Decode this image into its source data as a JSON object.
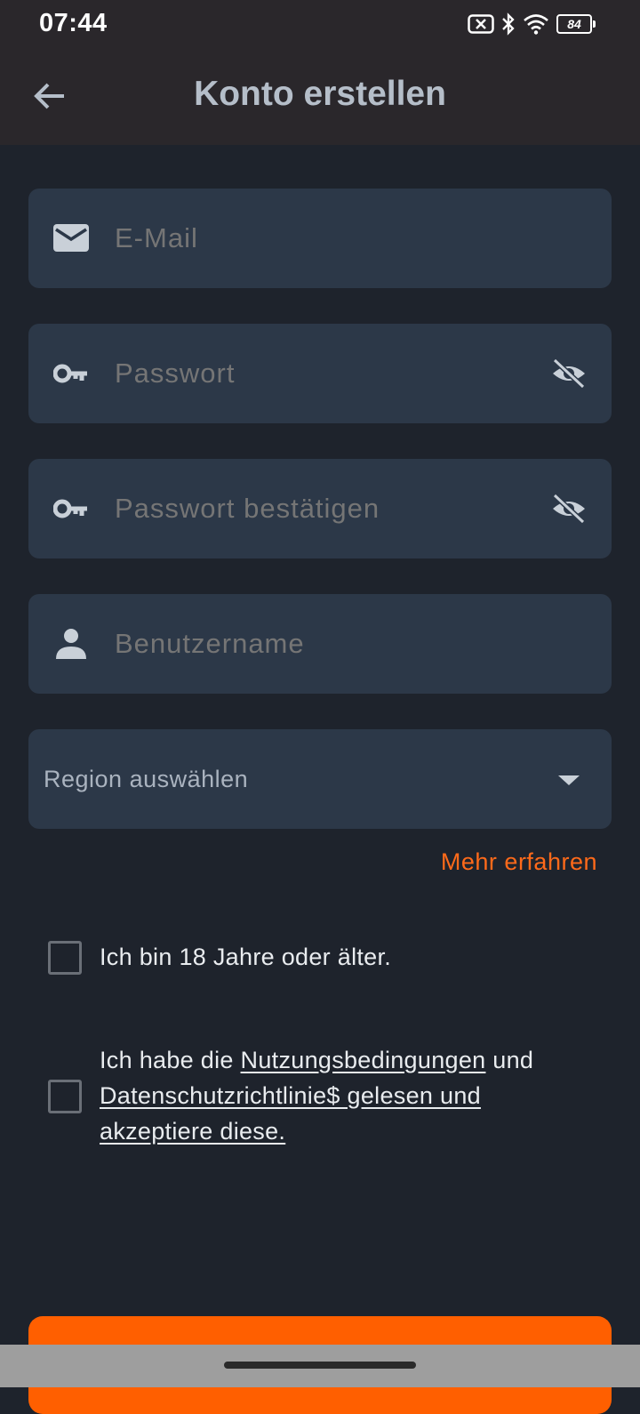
{
  "status_bar": {
    "time": "07:44",
    "battery_level": "84",
    "icons": [
      "sim-off-icon",
      "bluetooth-icon",
      "wifi-icon",
      "battery-icon"
    ]
  },
  "header": {
    "title": "Konto erstellen",
    "back_icon": "arrow-back-icon"
  },
  "form": {
    "email": {
      "placeholder": "E-Mail",
      "icon": "mail-icon"
    },
    "password": {
      "placeholder": "Passwort",
      "icon": "key-icon",
      "toggle_icon": "eye-off-icon"
    },
    "password_confirm": {
      "placeholder": "Passwort bestätigen",
      "icon": "key-icon",
      "toggle_icon": "eye-off-icon"
    },
    "username": {
      "placeholder": "Benutzername",
      "icon": "person-icon"
    },
    "region": {
      "placeholder": "Region auswählen",
      "icon": "caret-down-icon"
    },
    "learn_more": "Mehr erfahren",
    "age_check": {
      "label": "Ich bin 18 Jahre oder älter.",
      "checked": false
    },
    "terms_check": {
      "prefix": "Ich habe die ",
      "terms_link": "Nutzungsbedingungen",
      "middle": " und",
      "privacy_link": "Datenschutzrichtlinie$ gelesen und akzeptiere diese.",
      "checked": false
    }
  },
  "colors": {
    "background": "#1e232c",
    "app_bar": "#2a272b",
    "field": "#2c3848",
    "accent": "#ff5f00",
    "link": "#ff6a1a"
  }
}
